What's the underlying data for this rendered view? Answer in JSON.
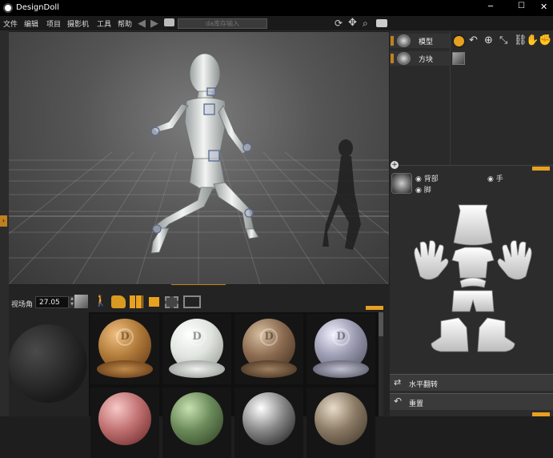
{
  "window": {
    "title": "DesignDoll",
    "controls": [
      "─",
      "☐",
      "✕"
    ]
  },
  "menu": {
    "items": [
      "文件",
      "编辑",
      "项目",
      "摄影机",
      "工具",
      "帮助"
    ],
    "search_placeholder": "da库存输入"
  },
  "bottom": {
    "fov_label": "视场角",
    "fov_value": "27.05",
    "materials": [
      {
        "color": "#b07a3a"
      },
      {
        "color": "#e8ece6"
      },
      {
        "color": "#8a6a50"
      },
      {
        "color": "#9a9ab0"
      },
      {
        "color": "#c07070"
      },
      {
        "color": "#6a8a5a"
      },
      {
        "color": "#888888"
      },
      {
        "color": "#8a7a66"
      }
    ]
  },
  "right": {
    "tree": [
      {
        "label": "模型",
        "icon": "doll-icon"
      },
      {
        "label": "方块",
        "icon": "doll-icon"
      }
    ],
    "parts": [
      {
        "label": "背部"
      },
      {
        "label": "手"
      },
      {
        "label": "脚"
      }
    ],
    "actions": {
      "flip_label": "水平翻转",
      "reset_label": "重置"
    }
  },
  "colors": {
    "accent": "#e8a020",
    "panel": "#2c2c2c",
    "viewport_bg": "#5a5a5a"
  }
}
